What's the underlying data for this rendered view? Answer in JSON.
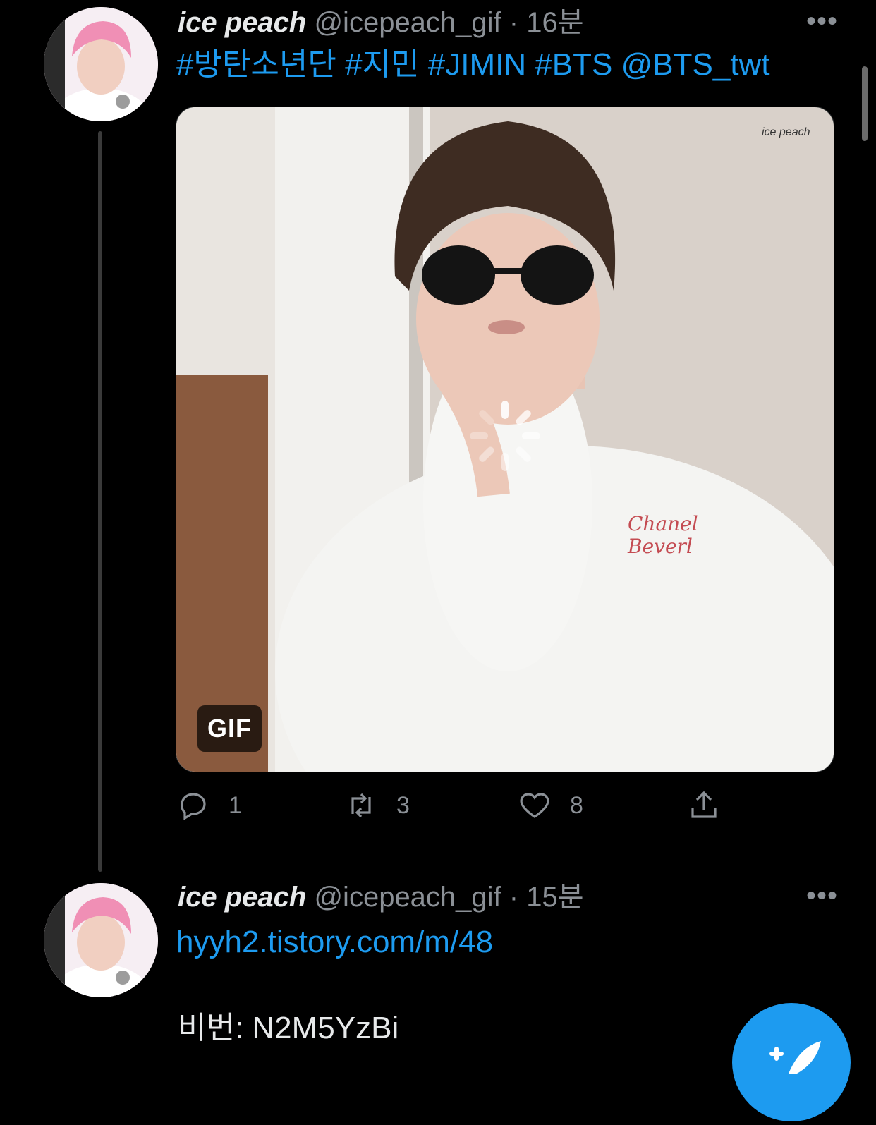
{
  "tweets": [
    {
      "name": "ice peach",
      "handle": "@icepeach_gif",
      "time": "· 16분",
      "more": "•••",
      "text": "#방탄소년단 #지민 #JIMIN #BTS @BTS_twt",
      "media": {
        "badge": "GIF",
        "watermark": "ice peach",
        "loading": true
      },
      "stats": {
        "replies": "1",
        "retweets": "3",
        "likes": "8"
      }
    },
    {
      "name": "ice peach",
      "handle": "@icepeach_gif",
      "time": "· 15분",
      "more": "•••",
      "link": "hyyh2.tistory.com/m/48",
      "text2": "비번: N2M5YzBi"
    }
  ],
  "icons": {
    "reply": "reply-icon",
    "retweet": "retweet-icon",
    "like": "heart-icon",
    "share": "share-icon",
    "compose": "compose-icon"
  },
  "colors": {
    "accent": "#1d9bf0",
    "muted": "#8b9096",
    "background": "#000000"
  }
}
